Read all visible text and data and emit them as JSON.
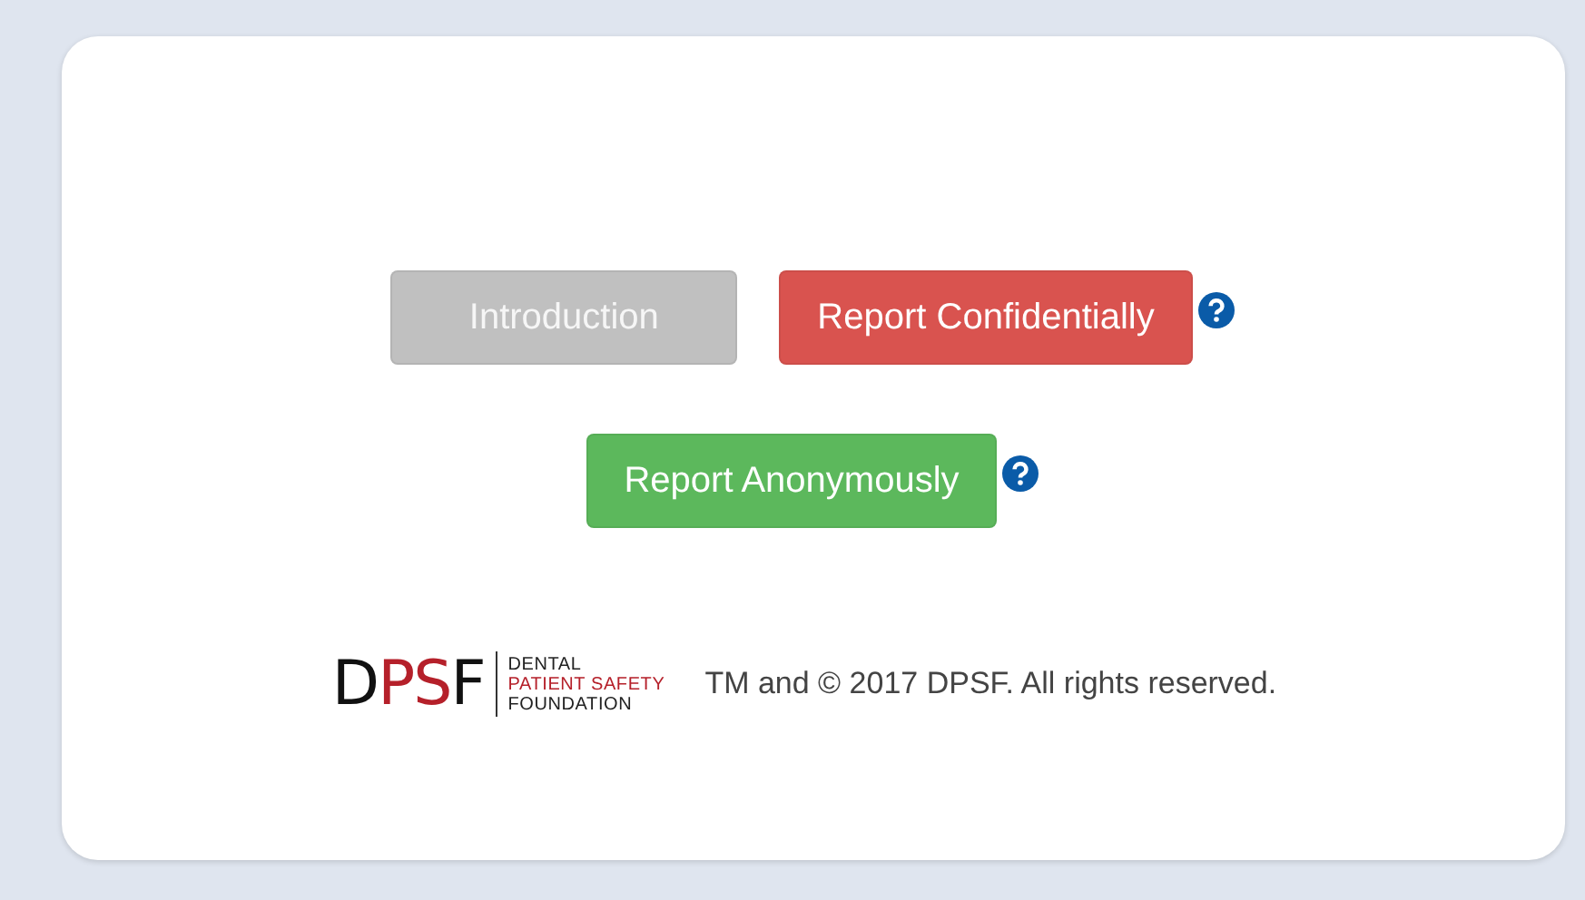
{
  "button_rows": [
    {
      "buttons": [
        {
          "label": "Introduction",
          "kind": "muted",
          "help": false
        },
        {
          "label": "Report Confidentially",
          "kind": "danger",
          "help": true
        }
      ]
    },
    {
      "buttons": [
        {
          "label": "Report Anonymously",
          "kind": "success",
          "help": true
        }
      ]
    }
  ],
  "footer": {
    "logo": {
      "letters": [
        {
          "text": "D",
          "color": "#111111"
        },
        {
          "text": "PS",
          "color": "#b5202a"
        },
        {
          "text": "F",
          "color": "#111111"
        }
      ],
      "lines": [
        {
          "text": "DENTAL",
          "color": "#222222"
        },
        {
          "text": "PATIENT SAFETY",
          "color": "#b5202a"
        },
        {
          "text": "FOUNDATION",
          "color": "#222222"
        }
      ]
    },
    "copyright": "TM and © 2017 DPSF. All rights reserved."
  }
}
